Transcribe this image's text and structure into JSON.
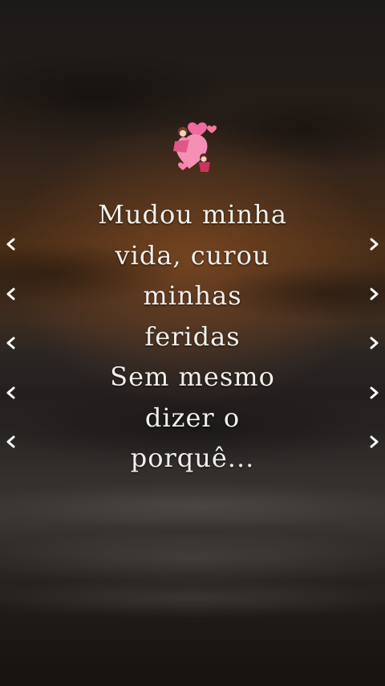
{
  "lyrics": {
    "lines": [
      "Mudou minha",
      "vida, curou",
      "minhas",
      "feridas",
      "Sem mesmo",
      "dizer o",
      "porquê..."
    ]
  },
  "sticker": {
    "icon": "couple-hearts-icon"
  },
  "decorations": {
    "left_icon": "chevron-left-icon",
    "right_icon": "chevron-right-icon"
  },
  "colors": {
    "text": "#f2f0ec",
    "heart": "#f06aa0",
    "sky_glow": "#8a4a22"
  }
}
